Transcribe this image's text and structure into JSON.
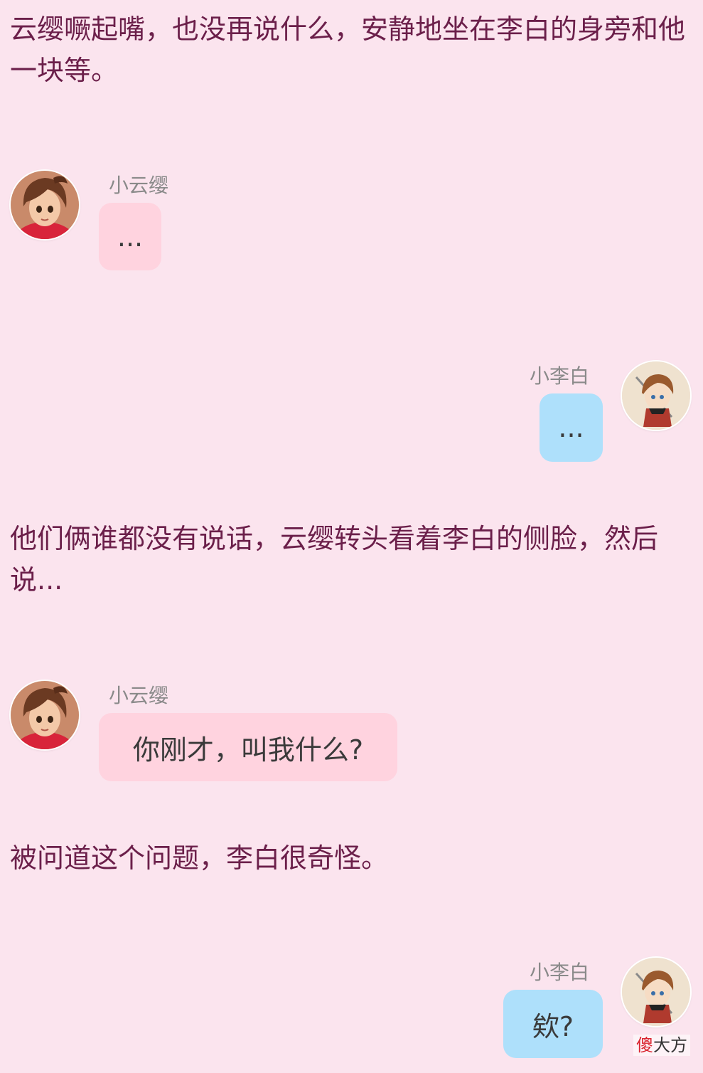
{
  "narration": [
    "云缨噘起嘴，也没再说什么，安静地坐在李白的身旁和他一块等。",
    "他们俩谁都没有说话，云缨转头看着李白的侧脸，然后说...",
    "被问道这个问题，李白很奇怪。"
  ],
  "messages": [
    {
      "speaker": "小云缨",
      "text": "...",
      "side": "left",
      "avatar_icon": "yunying-avatar-icon"
    },
    {
      "speaker": "小李白",
      "text": "...",
      "side": "right",
      "avatar_icon": "libai-avatar-icon"
    },
    {
      "speaker": "小云缨",
      "text": "你刚才，叫我什么?",
      "side": "left",
      "avatar_icon": "yunying-avatar-icon"
    },
    {
      "speaker": "小李白",
      "text": "欸?",
      "side": "right",
      "avatar_icon": "libai-avatar-icon"
    }
  ],
  "watermark": {
    "first": "傻",
    "rest": "大方"
  },
  "colors": {
    "background": "#fbe4ee",
    "narration_text": "#6b1f4a",
    "left_bubble": "#ffd3df",
    "right_bubble": "#aee0fb",
    "speaker_name": "#8a8a8a"
  }
}
